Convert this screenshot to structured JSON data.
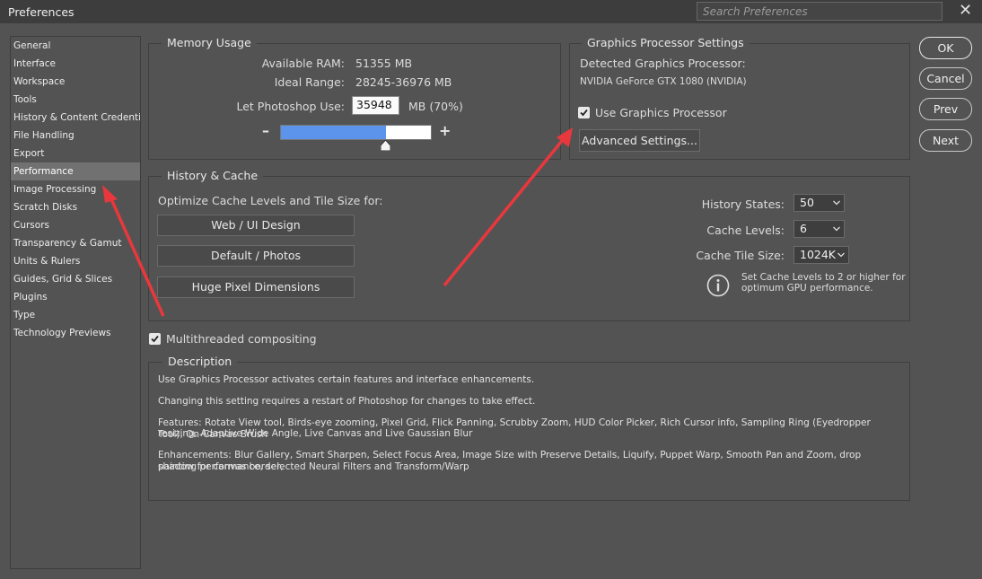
{
  "window": {
    "title": "Preferences",
    "search_placeholder": "Search Preferences"
  },
  "sidebar": {
    "items": [
      {
        "label": "General"
      },
      {
        "label": "Interface"
      },
      {
        "label": "Workspace"
      },
      {
        "label": "Tools"
      },
      {
        "label": "History & Content Credentials"
      },
      {
        "label": "File Handling"
      },
      {
        "label": "Export"
      },
      {
        "label": "Performance",
        "active": true
      },
      {
        "label": "Image Processing"
      },
      {
        "label": "Scratch Disks"
      },
      {
        "label": "Cursors"
      },
      {
        "label": "Transparency & Gamut"
      },
      {
        "label": "Units & Rulers"
      },
      {
        "label": "Guides, Grid & Slices"
      },
      {
        "label": "Plugins"
      },
      {
        "label": "Type"
      },
      {
        "label": "Technology Previews"
      }
    ]
  },
  "memory": {
    "legend": "Memory Usage",
    "available_label": "Available RAM:",
    "available_value": "51355 MB",
    "ideal_label": "Ideal Range:",
    "ideal_value": "28245-36976 MB",
    "let_label": "Let Photoshop Use:",
    "let_value": "35948",
    "let_unit": "MB (70%)",
    "slider_fraction": 0.7,
    "minus": "–",
    "plus": "+"
  },
  "gpu": {
    "legend": "Graphics Processor Settings",
    "detected_label": "Detected Graphics Processor:",
    "detected_value": "NVIDIA GeForce GTX 1080 (NVIDIA)",
    "use_label": "Use Graphics Processor",
    "use_checked": true,
    "advanced_button": "Advanced Settings..."
  },
  "history_cache": {
    "legend": "History & Cache",
    "optimize_label": "Optimize Cache Levels and Tile Size for:",
    "buttons": [
      "Web / UI Design",
      "Default / Photos",
      "Huge Pixel Dimensions"
    ],
    "history_states_label": "History States:",
    "history_states_value": "50",
    "cache_levels_label": "Cache Levels:",
    "cache_levels_value": "6",
    "cache_tile_label": "Cache Tile Size:",
    "cache_tile_value": "1024K",
    "info_line1": "Set Cache Levels to 2 or higher for",
    "info_line2": "optimum GPU performance."
  },
  "multithreaded": {
    "label": "Multithreaded compositing",
    "checked": true
  },
  "description": {
    "legend": "Description",
    "p1": "Use Graphics Processor activates certain features and interface enhancements.",
    "p2": "Changing this setting requires a restart of Photoshop for changes to take effect.",
    "p3a": "Features: Rotate View tool, Birds-eye zooming, Pixel Grid, Flick Panning, Scrubby Zoom, HUD Color Picker, Rich Cursor info, Sampling Ring (Eyedropper Tool), On-Canvas Brush",
    "p3b": "resizing, Adaptive Wide Angle, Live Canvas and Live Gaussian Blur",
    "p4a": "Enhancements: Blur Gallery, Smart Sharpen, Select Focus Area, Image Size with Preserve Details, Liquify, Puppet Warp, Smooth Pan and Zoom, drop shadow for canvas border,",
    "p4b": "painting performance, selected Neural Filters and Transform/Warp"
  },
  "actions": {
    "ok": "OK",
    "cancel": "Cancel",
    "prev": "Prev",
    "next": "Next"
  },
  "colors": {
    "background": "#535353",
    "titlebar": "#3d3d3d",
    "slider_fill": "#5c94ec",
    "annotation_arrow": "#e8383d"
  }
}
